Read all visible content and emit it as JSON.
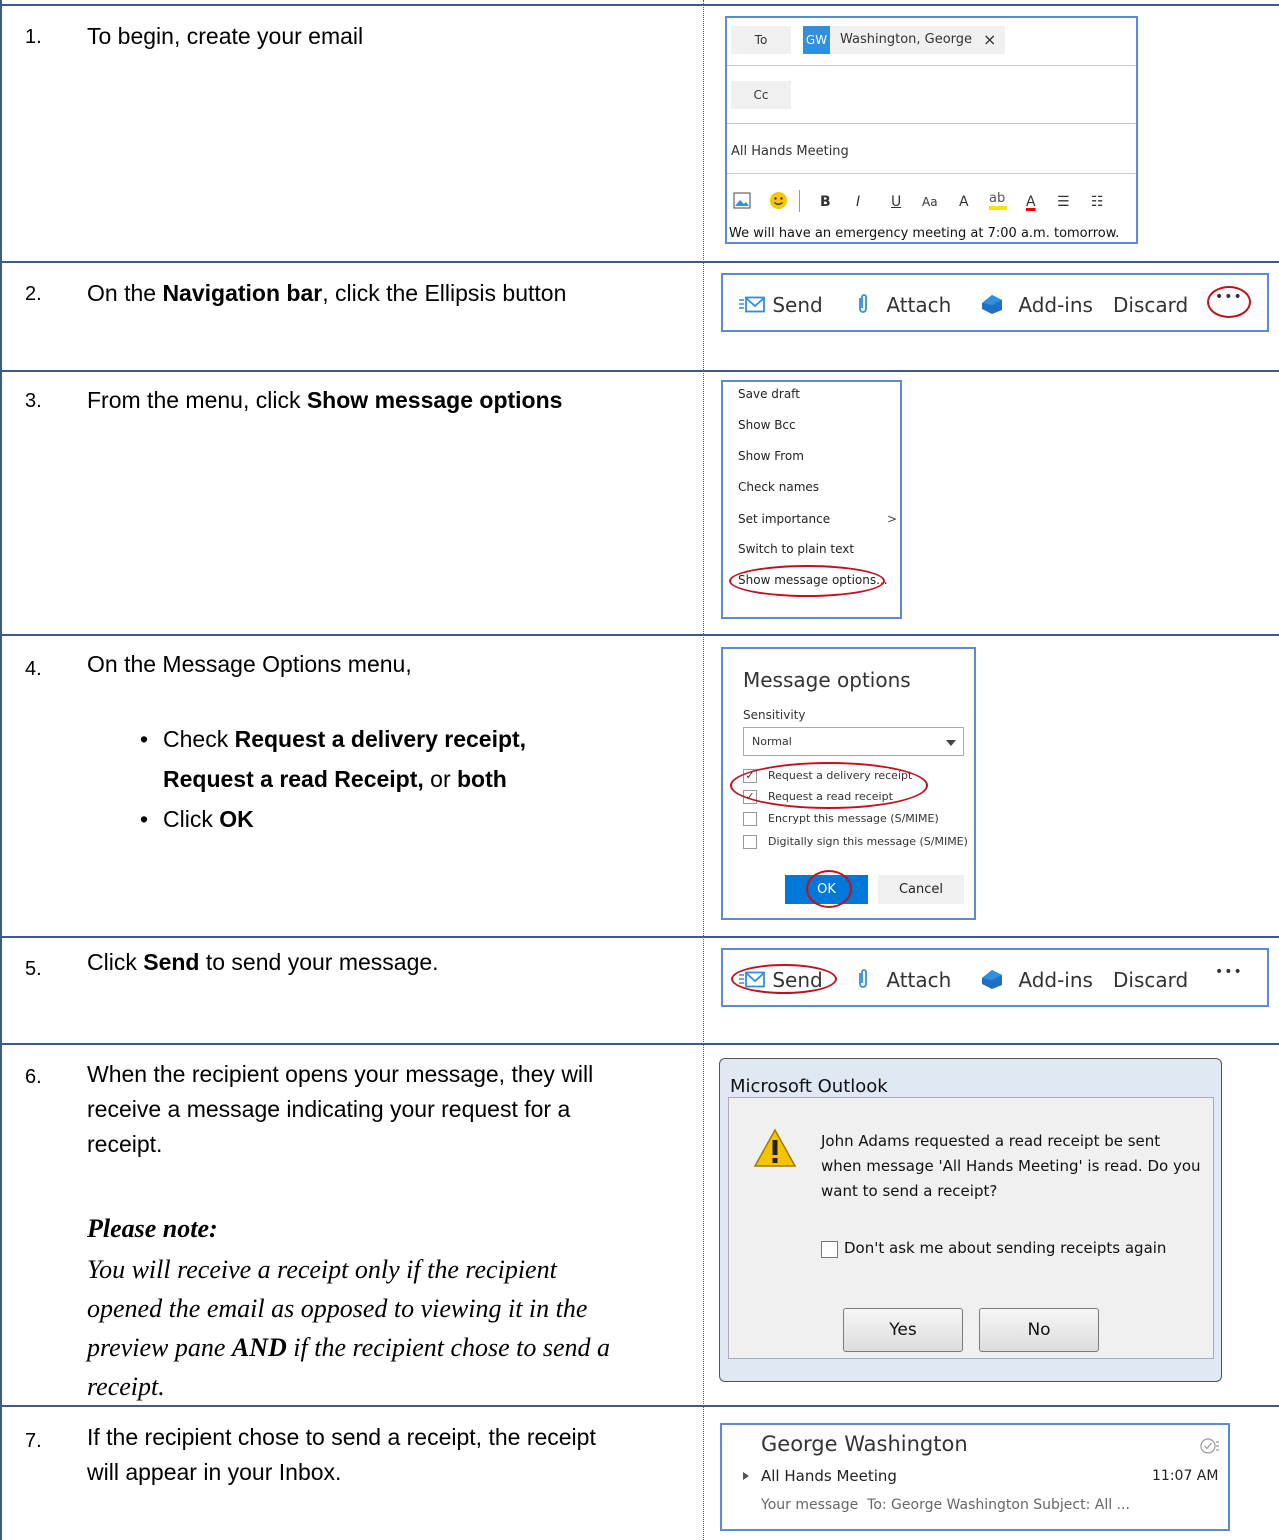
{
  "steps": [
    {
      "number": "1.",
      "text": "To begin, create your email"
    },
    {
      "number": "2.",
      "text_before": "On the ",
      "text_bold": "Navigation bar",
      "text_after": ", click the Ellipsis button"
    },
    {
      "number": "3.",
      "text_before": "From the menu, click ",
      "text_bold": "Show message options"
    },
    {
      "number": "4.",
      "text": "On the Message Options menu,",
      "bullet1_before": "Check ",
      "bullet1_bold_a": "Request a delivery receipt,",
      "bullet1_bold_b": "Request a read Receipt,",
      "bullet1_mid": " or ",
      "bullet1_bold_c": "both",
      "bullet2_before": "Click ",
      "bullet2_bold": "OK"
    },
    {
      "number": "5.",
      "text_bold": "Send",
      "text_before": "Click ",
      "text_after": " to send your message."
    },
    {
      "number": "6.",
      "line1": "When the recipient opens your message, they will",
      "line2": "receive a message indicating your request for a",
      "line3": "receipt.",
      "note_title": "Please note:",
      "note_l1": "You will receive a receipt only if the recipient",
      "note_l2": "opened the email as opposed to viewing it in the",
      "note_l3a": "preview pane ",
      "note_l3b": "AND",
      "note_l3c": " if the recipient chose to send a",
      "note_l4": "receipt."
    },
    {
      "number": "7.",
      "line1": "If the recipient chose to send a receipt, the receipt",
      "line2": "will appear in your Inbox."
    }
  ],
  "compose": {
    "to_label": "To",
    "recipient_initials": "GW",
    "recipient_name": "Washington, George",
    "remove_glyph": "×",
    "cc_label": "Cc",
    "subject": "All Hands Meeting",
    "body": "We will have an emergency meeting at 7:00 a.m. tomorrow.",
    "format_buttons": [
      "B",
      "I",
      "U",
      "Aa",
      "A",
      "A",
      "☰",
      "☷"
    ]
  },
  "toolbar": {
    "send": "Send",
    "attach": "Attach",
    "addins": "Add-ins",
    "discard": "Discard",
    "more": "•••"
  },
  "menu": {
    "items": [
      "Save draft",
      "Show Bcc",
      "Show From",
      "Check names",
      "Set importance",
      "Switch to plain text",
      "Show message options..."
    ],
    "submenu_glyph": ">"
  },
  "message_options": {
    "title": "Message options",
    "sensitivity_label": "Sensitivity",
    "sensitivity_value": "Normal",
    "checkboxes": [
      {
        "label": "Request a delivery receipt",
        "checked": true
      },
      {
        "label": "Request a read receipt",
        "checked": true
      },
      {
        "label": "Encrypt this message (S/MIME)",
        "checked": false
      },
      {
        "label": "Digitally sign this message (S/MIME)",
        "checked": false
      }
    ],
    "ok": "OK",
    "cancel": "Cancel"
  },
  "dialog": {
    "title": "Microsoft Outlook",
    "message_l1": "John Adams requested a read receipt be sent",
    "message_l2": "when message 'All Hands Meeting' is read. Do you",
    "message_l3": "want to send a receipt?",
    "checkbox_label": "Don't ask me about sending receipts again",
    "yes": "Yes",
    "no": "No"
  },
  "inbox_item": {
    "sender": "George Washington",
    "subject": "All Hands Meeting",
    "time": "11:07 AM",
    "preview": "Your message  To: George Washington Subject: All ..."
  },
  "colors": {
    "border": "#3d5b86",
    "accent_blue": "#2f8fe0",
    "highlight_red": "#c0121c"
  }
}
